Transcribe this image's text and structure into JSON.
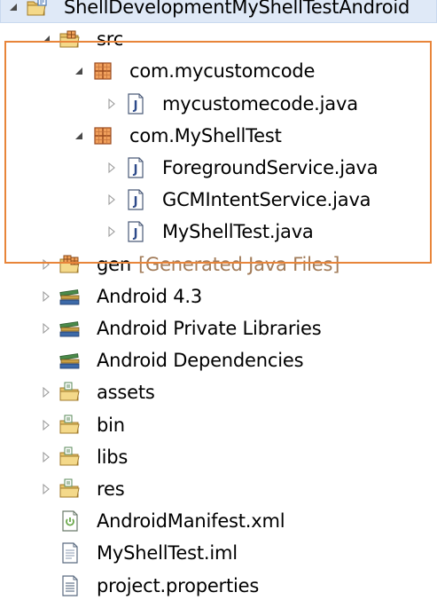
{
  "colors": {
    "selection_highlight": "#dfe9f7",
    "callout_border": "#e8853a",
    "decoration_text": "#a27c5a"
  },
  "tree": [
    {
      "id": "project",
      "label": "ShellDevelopmentMyShellTestAndroid",
      "icon": "project-folder-icon",
      "level": 0,
      "expander": "expanded",
      "highlighted": true
    },
    {
      "id": "src",
      "label": "src",
      "icon": "source-folder-icon",
      "level": 1,
      "expander": "expanded"
    },
    {
      "id": "pkg-mycustomcode",
      "label": "com.mycustomcode",
      "icon": "package-icon",
      "level": 2,
      "expander": "expanded"
    },
    {
      "id": "file-mycustomecode",
      "label": "mycustomecode.java",
      "icon": "java-file-icon",
      "level": 3,
      "expander": "collapsed"
    },
    {
      "id": "pkg-myshelltest",
      "label": "com.MyShellTest",
      "icon": "package-icon",
      "level": 2,
      "expander": "expanded"
    },
    {
      "id": "file-foreground",
      "label": "ForegroundService.java",
      "icon": "java-file-icon",
      "level": 3,
      "expander": "collapsed"
    },
    {
      "id": "file-gcm",
      "label": "GCMIntentService.java",
      "icon": "java-file-icon",
      "level": 3,
      "expander": "collapsed"
    },
    {
      "id": "file-myshelltest",
      "label": "MyShellTest.java",
      "icon": "java-file-icon",
      "level": 3,
      "expander": "collapsed"
    },
    {
      "id": "gen",
      "label": "gen",
      "decoration": "[Generated Java Files]",
      "icon": "generated-source-folder-icon",
      "level": 1,
      "expander": "collapsed"
    },
    {
      "id": "android-43",
      "label": "Android 4.3",
      "icon": "library-icon",
      "level": 1,
      "expander": "collapsed"
    },
    {
      "id": "android-private-libs",
      "label": "Android Private Libraries",
      "icon": "library-icon",
      "level": 1,
      "expander": "collapsed"
    },
    {
      "id": "android-deps",
      "label": "Android Dependencies",
      "icon": "library-icon",
      "level": 1,
      "expander": "none"
    },
    {
      "id": "assets",
      "label": "assets",
      "icon": "folder-icon",
      "level": 1,
      "expander": "collapsed"
    },
    {
      "id": "bin",
      "label": "bin",
      "icon": "folder-icon",
      "level": 1,
      "expander": "collapsed"
    },
    {
      "id": "libs",
      "label": "libs",
      "icon": "folder-icon",
      "level": 1,
      "expander": "collapsed"
    },
    {
      "id": "res",
      "label": "res",
      "icon": "folder-icon",
      "level": 1,
      "expander": "collapsed"
    },
    {
      "id": "manifest",
      "label": "AndroidManifest.xml",
      "icon": "android-manifest-icon",
      "level": 1,
      "expander": "none"
    },
    {
      "id": "iml",
      "label": "MyShellTest.iml",
      "icon": "text-file-icon",
      "level": 1,
      "expander": "none"
    },
    {
      "id": "properties",
      "label": "project.properties",
      "icon": "properties-file-icon",
      "level": 1,
      "expander": "none"
    }
  ]
}
